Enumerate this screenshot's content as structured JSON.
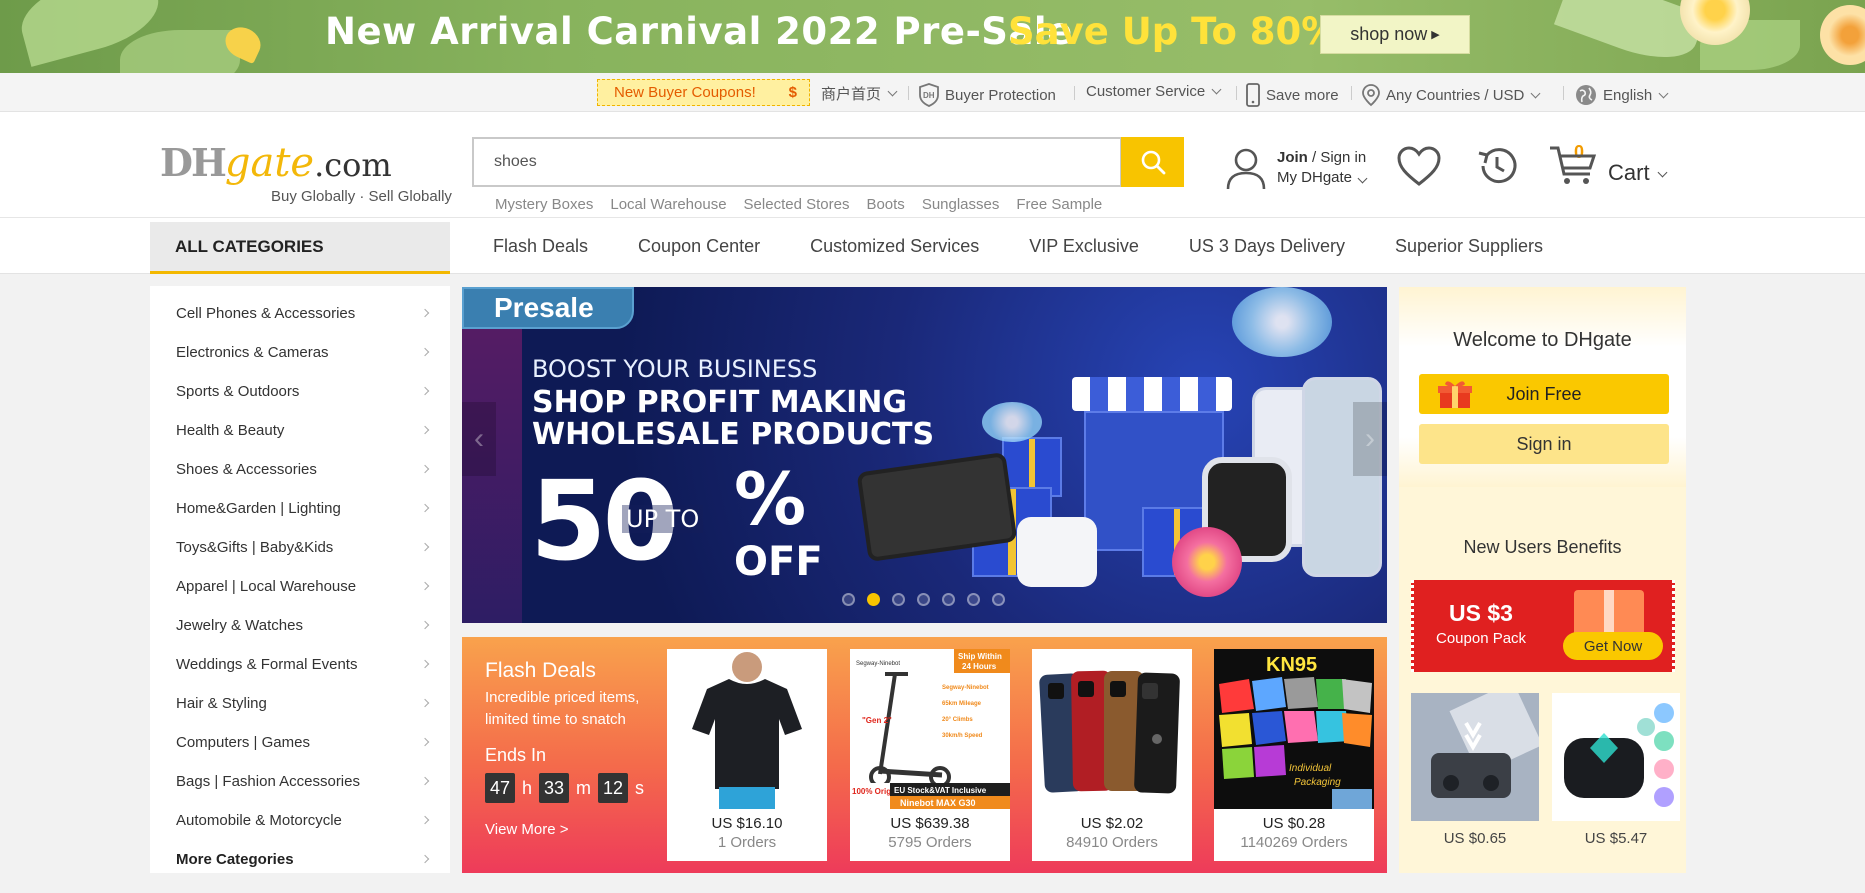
{
  "promo_banner": {
    "title": "New Arrival Carnival 2022 Pre-Sale",
    "save": "Save Up To  80%",
    "shop_now": "shop now"
  },
  "util_bar": {
    "coupon": "New Buyer Coupons!",
    "coupon_symbol": "$",
    "merchant_home": "商户首页",
    "buyer_protection": "Buyer Protection",
    "customer_service": "Customer Service",
    "save_more": "Save more",
    "region": "Any Countries / USD",
    "language": "English"
  },
  "header": {
    "logo_dh": "DH",
    "logo_gate": "gate",
    "logo_com": ".com",
    "tagline": "Buy Globally · Sell Globally",
    "search_value": "shoes",
    "hot_words": [
      "Mystery Boxes",
      "Local Warehouse",
      "Selected Stores",
      "Boots",
      "Sunglasses",
      "Free Sample"
    ],
    "join": "Join",
    "sign_in": " / Sign in",
    "my_dhgate": "My DHgate",
    "cart_count": "0",
    "cart_label": "Cart"
  },
  "nav": {
    "all_categories": "ALL CATEGORIES",
    "links": [
      "Flash Deals",
      "Coupon Center",
      "Customized Services",
      "VIP Exclusive",
      "US 3 Days Delivery",
      "Superior Suppliers"
    ]
  },
  "categories": [
    "Cell Phones & Accessories",
    "Electronics & Cameras",
    "Sports & Outdoors",
    "Health & Beauty",
    "Shoes & Accessories",
    "Home&Garden  | Lighting",
    "Toys&Gifts  | Baby&Kids",
    "Apparel  | Local Warehouse",
    "Jewelry & Watches",
    "Weddings & Formal Events",
    "Hair & Styling",
    "Computers  | Games",
    "Bags  | Fashion Accessories",
    "Automobile & Motorcycle",
    "More Categories"
  ],
  "hero": {
    "presale": "Presale",
    "boost": "BOOST YOUR BUSINESS",
    "headline_1": "SHOP PROFIT MAKING",
    "headline_2": "WHOLESALE PRODUCTS",
    "fifty": "50",
    "up_to": "UP TO",
    "percent": "%",
    "off": "OFF",
    "slide_count": 7,
    "active_slide": 2
  },
  "flash_deals": {
    "title": "Flash Deals",
    "subtitle": "Incredible priced items, limited time to snatch",
    "ends_in": "Ends In",
    "hours": "47",
    "h": "h",
    "minutes": "33",
    "m": "m",
    "seconds": "12",
    "s": "s",
    "view_more": "View More  >",
    "products": [
      {
        "price": "US $16.10",
        "orders": "1 Orders"
      },
      {
        "price": "US $639.38",
        "orders": "5795 Orders"
      },
      {
        "price": "US $2.02",
        "orders": "84910 Orders"
      },
      {
        "price": "US $0.28",
        "orders": "1140269 Orders"
      }
    ],
    "scooter_text": {
      "ship_within": "Ship Within",
      "hours_24": "24 Hours",
      "brand": "Segway-Ninebot",
      "gen": "\"Gen 2\"",
      "spec1": "Segway-Ninebot",
      "spec2": "65km Mileage",
      "spec3": "20° Climbs",
      "spec4": "30km/h Speed",
      "original": "100% Original",
      "eu_stock": "EU Stock&VAT Inclusive",
      "model": "Ninebot MAX G30"
    },
    "mask_text": {
      "kn95": "KN95",
      "individual": "Individual",
      "packaging": "Packaging"
    }
  },
  "right_panel": {
    "welcome": "Welcome to DHgate",
    "join_free": "Join Free",
    "sign_in": "Sign in",
    "benefits_title": "New Users Benefits",
    "coupon_amount": "US $3",
    "coupon_label": "Coupon Pack",
    "get_now": "Get Now",
    "products": [
      {
        "price": "US $0.65"
      },
      {
        "price": "US $5.47"
      }
    ]
  },
  "colors": {
    "accent": "#f8c400",
    "coupon_red": "#e02020",
    "orange": "#f29b00"
  }
}
